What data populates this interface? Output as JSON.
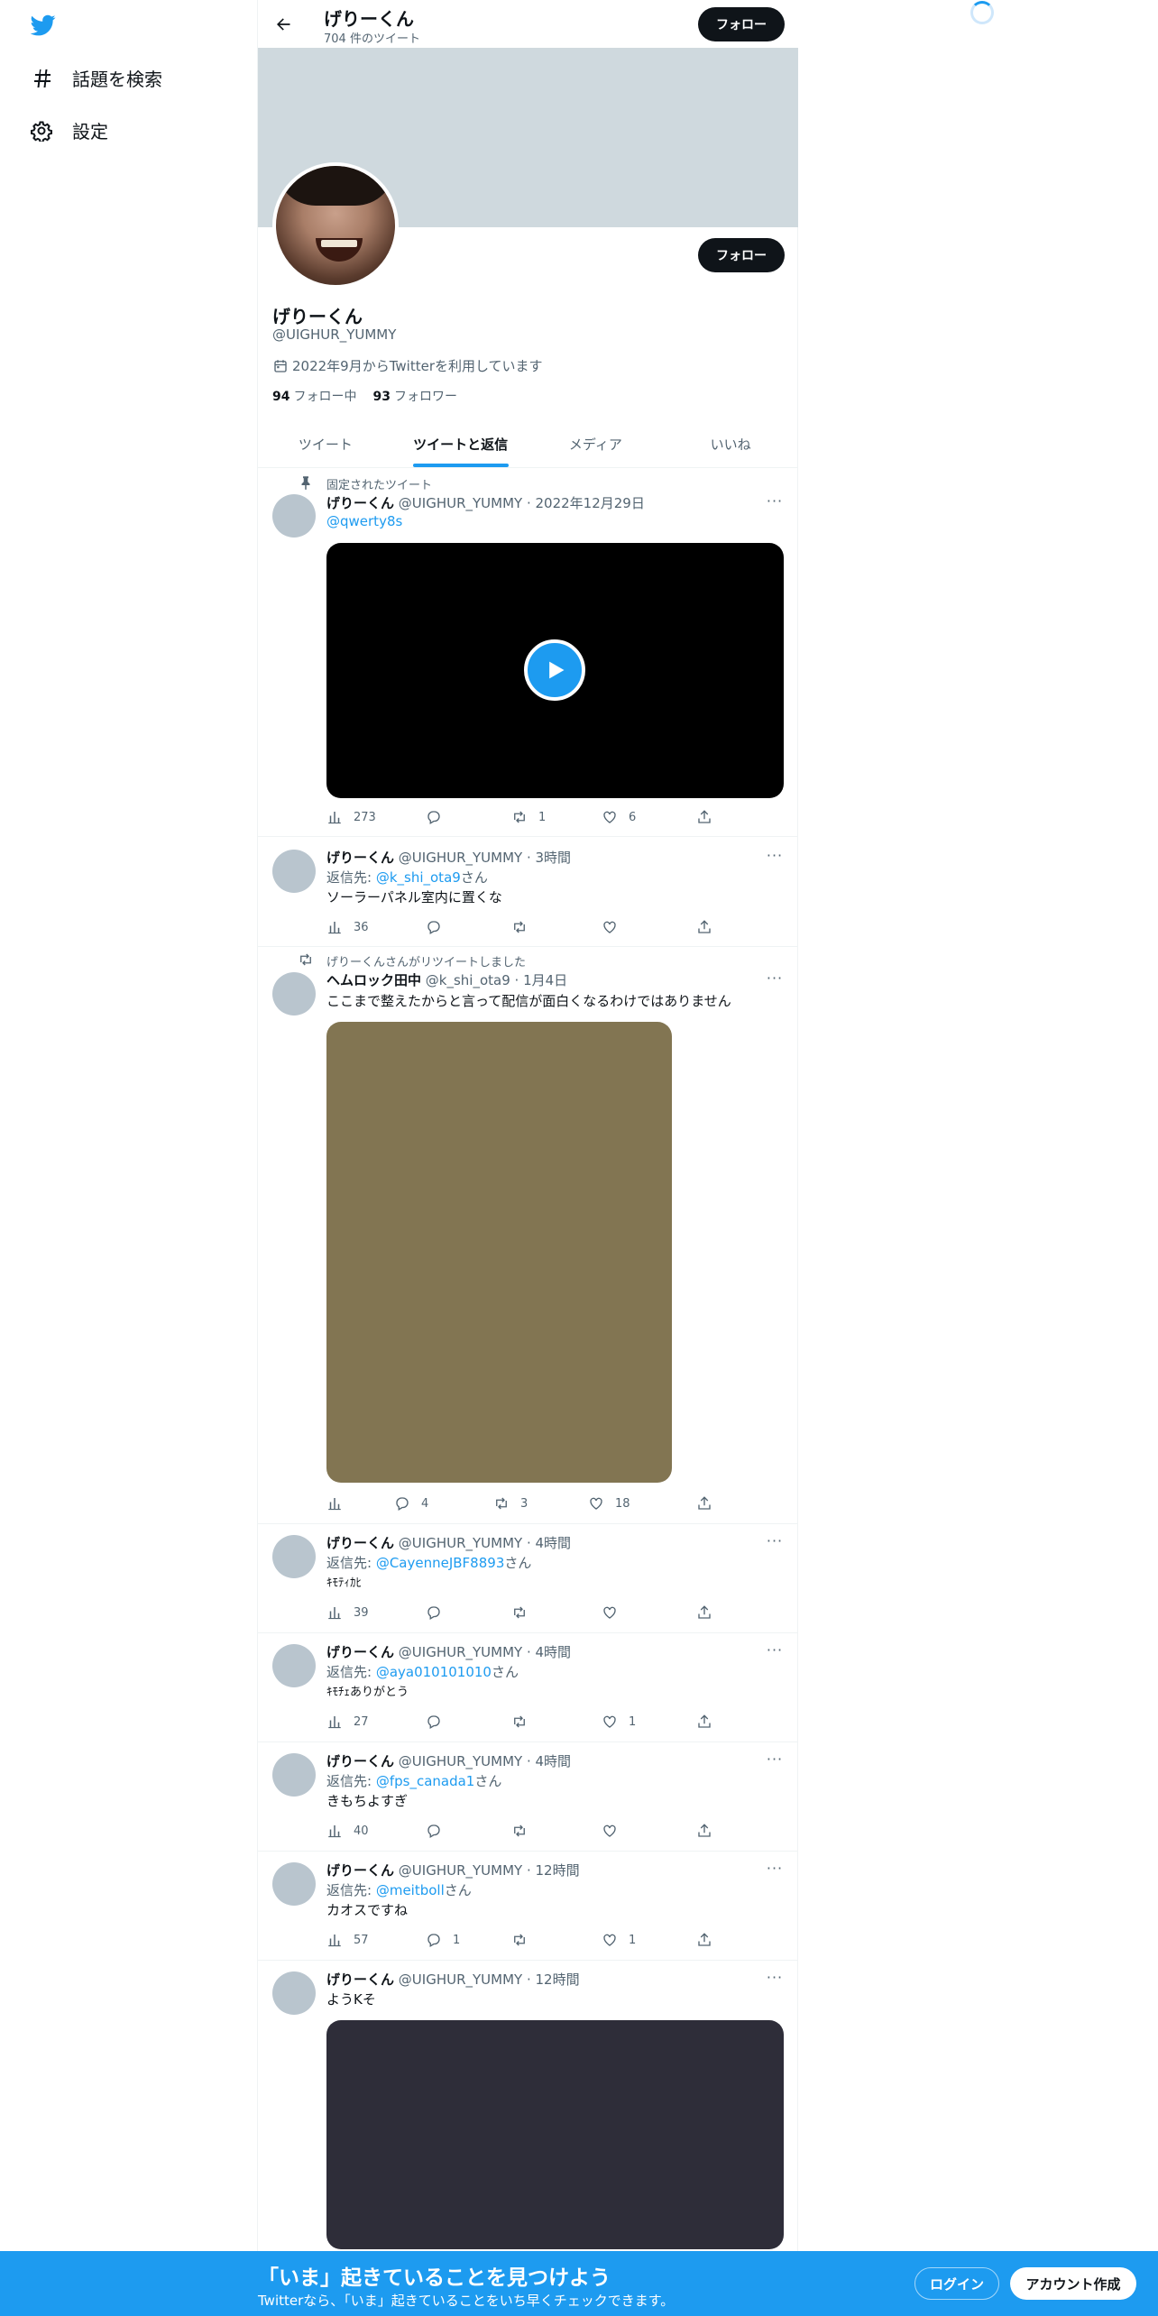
{
  "sidebar": {
    "items": [
      {
        "label": "話題を検索",
        "icon": "hashtag-icon"
      },
      {
        "label": "設定",
        "icon": "gear-icon"
      }
    ]
  },
  "header": {
    "title": "げりーくん",
    "subtitle": "704 件のツイート",
    "follow_label": "フォロー"
  },
  "profile": {
    "name": "げりーくん",
    "handle": "@UIGHUR_YUMMY",
    "joined": "2022年9月からTwitterを利用しています",
    "following_count": "94",
    "following_label": "フォロー中",
    "followers_count": "93",
    "followers_label": "フォロワー",
    "follow_label": "フォロー"
  },
  "tabs": [
    {
      "label": "ツイート"
    },
    {
      "label": "ツイートと返信"
    },
    {
      "label": "メディア"
    },
    {
      "label": "いいね"
    }
  ],
  "tweets": [
    {
      "context": "固定されたツイート",
      "name": "げりーくん",
      "meta": "@UIGHUR_YUMMY · 2022年12月29日",
      "link": "@qwerty8s",
      "views": "273",
      "replies": "",
      "retweets": "1",
      "likes": "6"
    },
    {
      "name": "げりーくん",
      "meta": "@UIGHUR_YUMMY · 3時間",
      "reply_prefix": "返信先: ",
      "reply_to": "@k_shi_ota9",
      "reply_suffix": "さん",
      "text": "ソーラーパネル室内に置くな",
      "views": "36",
      "replies": "",
      "retweets": "",
      "likes": ""
    },
    {
      "context": "げりーくんさんがリツイートしました",
      "name": "ヘムロック田中",
      "meta": "@k_shi_ota9 · 1月4日",
      "text": "ここまで整えたからと言って配信が面白くなるわけではありません",
      "views": "",
      "replies": "4",
      "retweets": "3",
      "likes": "18"
    },
    {
      "name": "げりーくん",
      "meta": "@UIGHUR_YUMMY · 4時間",
      "reply_prefix": "返信先: ",
      "reply_to": "@CayenneJBF8893",
      "reply_suffix": "さん",
      "text": "ｷﾓﾃｨｶﾋ",
      "views": "39",
      "replies": "",
      "retweets": "",
      "likes": ""
    },
    {
      "name": "げりーくん",
      "meta": "@UIGHUR_YUMMY · 4時間",
      "reply_prefix": "返信先: ",
      "reply_to": "@aya010101010",
      "reply_suffix": "さん",
      "text": "ｷﾓﾁｪありがとう",
      "views": "27",
      "replies": "",
      "retweets": "",
      "likes": "1"
    },
    {
      "name": "げりーくん",
      "meta": "@UIGHUR_YUMMY · 4時間",
      "reply_prefix": "返信先: ",
      "reply_to": "@fps_canada1",
      "reply_suffix": "さん",
      "text": "きもちよすぎ",
      "views": "40",
      "replies": "",
      "retweets": "",
      "likes": ""
    },
    {
      "name": "げりーくん",
      "meta": "@UIGHUR_YUMMY · 12時間",
      "reply_prefix": "返信先: ",
      "reply_to": "@meitboll",
      "reply_suffix": "さん",
      "text": "カオスですね",
      "views": "57",
      "replies": "1",
      "retweets": "",
      "likes": "1"
    },
    {
      "name": "げりーくん",
      "meta": "@UIGHUR_YUMMY · 12時間",
      "text": "ようKそ"
    }
  ],
  "bottom_bar": {
    "title": "「いま」起きていることを見つけよう",
    "subtitle": "Twitterなら、「いま」起きていることをいち早くチェックできます。",
    "login_label": "ログイン",
    "signup_label": "アカウント作成"
  },
  "colors": {
    "accent": "#1d9bf0",
    "banner": "#cfd9de",
    "dark": "#0f1419",
    "muted": "#536471"
  }
}
